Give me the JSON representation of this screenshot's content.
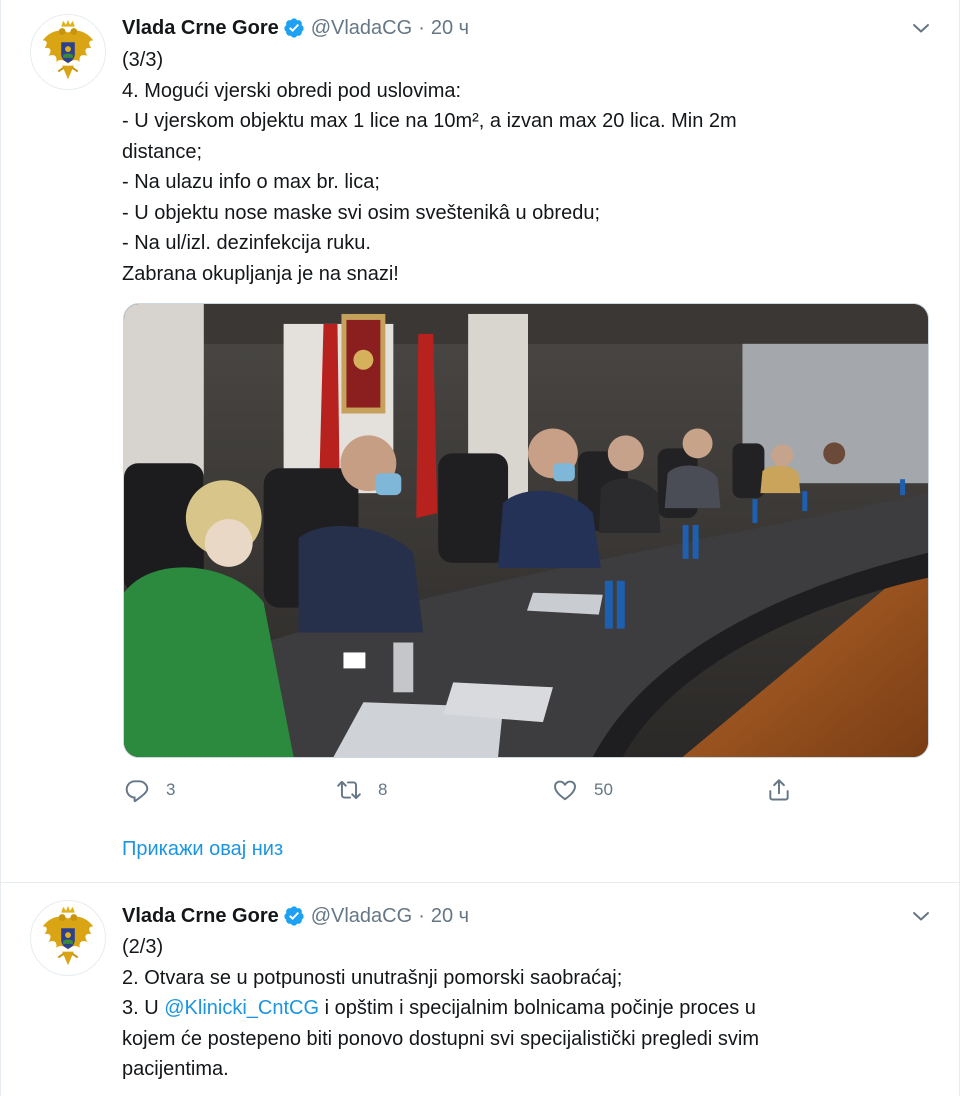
{
  "tweets": [
    {
      "display_name": "Vlada Crne Gore",
      "handle": "@VladaCG",
      "separator": "·",
      "time": "20 ч",
      "lines": [
        "(3/3)",
        "4. Mogući vjerski obredi pod uslovima:",
        "- U vjerskom objektu max 1 lice na 10m², a izvan max 20 lica. Min 2m",
        "distance;",
        "- Na ulazu info o max br. lica;",
        "- U objektu nose maske svi osim sveštenikâ u obredu;",
        "- Na ul/izl. dezinfekcija ruku.",
        "Zabrana okupljanja je na snazi!"
      ],
      "actions": {
        "reply_count": "3",
        "retweet_count": "8",
        "like_count": "50"
      },
      "show_thread": "Прикажи овај низ"
    },
    {
      "display_name": "Vlada Crne Gore",
      "handle": "@VladaCG",
      "separator": "·",
      "time": "20 ч",
      "line1": "(2/3)",
      "line2": "2. Otvara se u potpunosti unutrašnji pomorski saobraćaj;",
      "line3_pre": "3. U ",
      "line3_mention": "@Klinicki_CntCG",
      "line3_post": " i opštim i specijalnim bolnicama počinje proces u",
      "line4": "kojem će postepeno biti ponovo dostupni svi specijalistički pregledi svim",
      "line5": "pacijentima."
    }
  ],
  "icons": {
    "avatar": "montenegro-coat-of-arms",
    "verified": "verified-badge-icon",
    "menu": "chevron-down-icon",
    "reply": "reply-icon",
    "retweet": "retweet-icon",
    "like": "heart-icon",
    "share": "share-icon"
  },
  "colors": {
    "link": "#1b95e0",
    "secondary_text": "#657786",
    "verified": "#1da1f2"
  }
}
